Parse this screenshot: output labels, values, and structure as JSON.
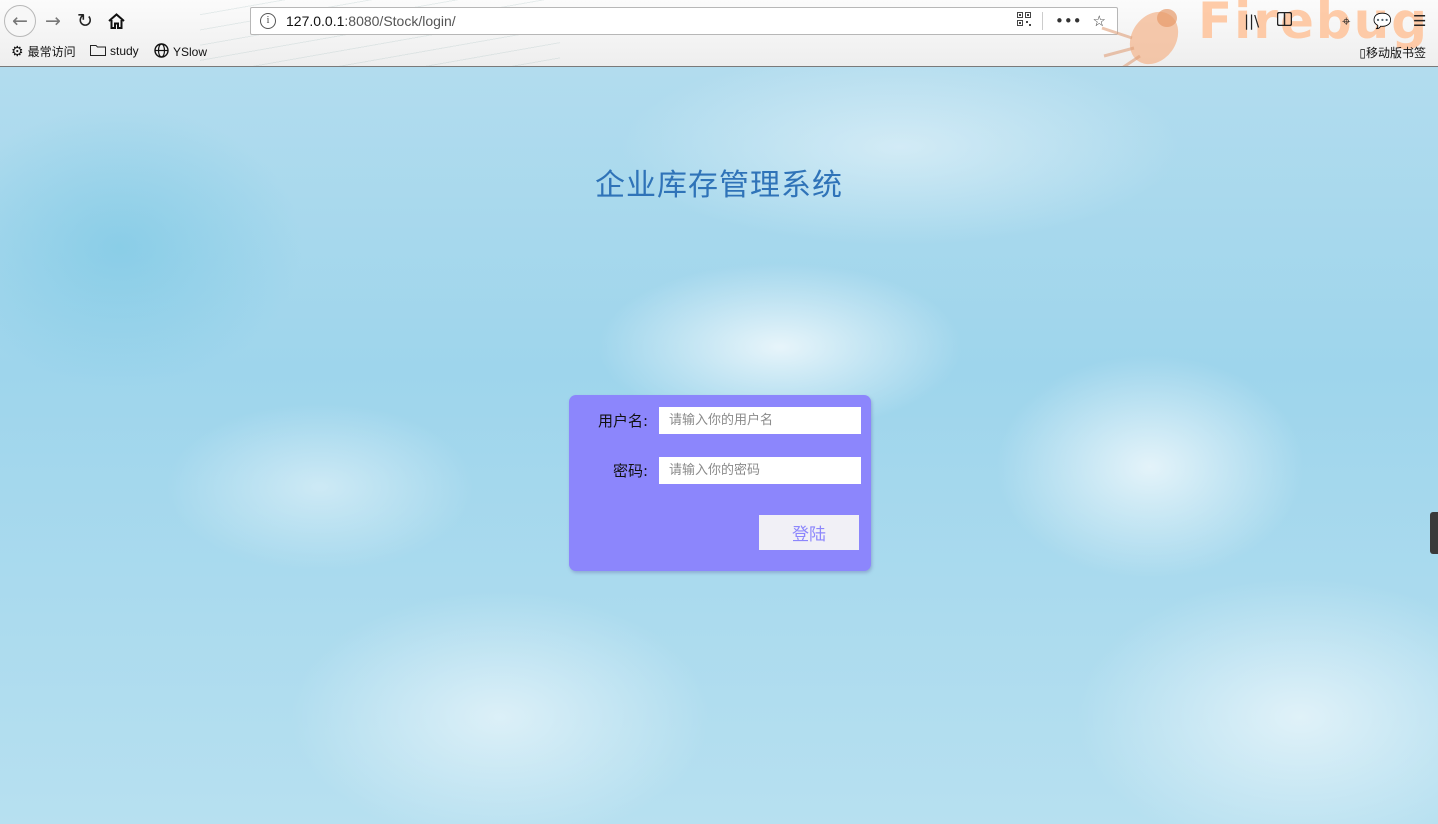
{
  "browser": {
    "url_host": "127.0.0.1",
    "url_path": ":8080/Stock/login/",
    "firebug_label": "Firebug",
    "bookmarks": [
      {
        "label": "最常访问",
        "icon": "gear-icon"
      },
      {
        "label": "study",
        "icon": "folder-icon"
      },
      {
        "label": "YSlow",
        "icon": "globe-icon"
      }
    ],
    "mobile_bookmarks_label": "移动版书签"
  },
  "page": {
    "title": "企业库存管理系统",
    "login": {
      "username_label": "用户名:",
      "username_placeholder": "请输入你的用户名",
      "password_label": "密码:",
      "password_placeholder": "请输入你的密码",
      "submit_label": "登陆"
    }
  },
  "colors": {
    "form_background": "#8c86fc",
    "title_color": "#2f73b8",
    "button_background": "#f1f0f6"
  }
}
